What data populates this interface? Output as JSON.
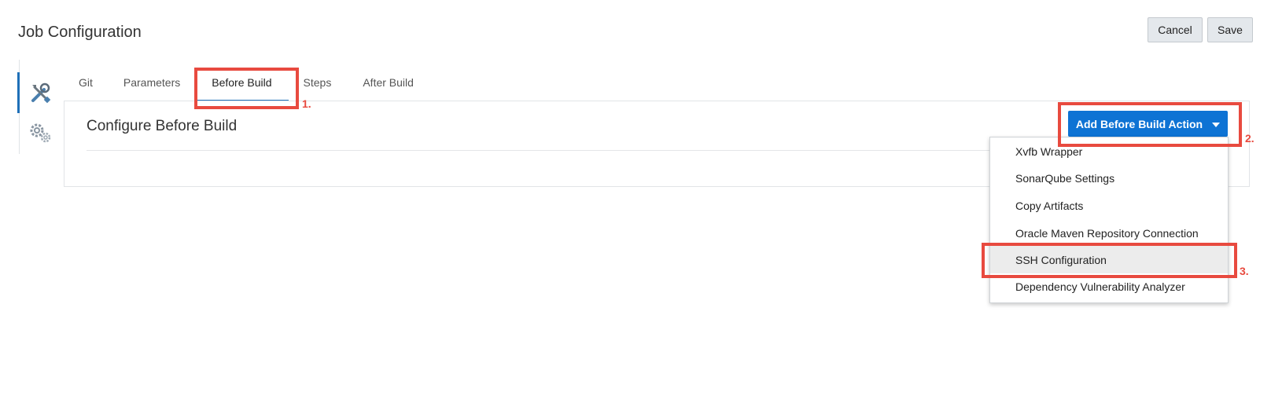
{
  "header": {
    "title": "Job Configuration",
    "cancel_label": "Cancel",
    "save_label": "Save"
  },
  "side_nav": {
    "items": [
      {
        "icon": "tools-icon",
        "active": true
      },
      {
        "icon": "gears-icon",
        "active": false
      }
    ]
  },
  "tabs": [
    {
      "label": "Git"
    },
    {
      "label": "Parameters"
    },
    {
      "label": "Before Build",
      "active": true
    },
    {
      "label": "Steps"
    },
    {
      "label": "After Build"
    }
  ],
  "panel": {
    "title": "Configure Before Build",
    "action_button_label": "Add Before Build Action"
  },
  "dropdown": {
    "items": [
      {
        "label": "Xvfb Wrapper"
      },
      {
        "label": "SonarQube Settings"
      },
      {
        "label": "Copy Artifacts"
      },
      {
        "label": "Oracle Maven Repository Connection"
      },
      {
        "label": "SSH Configuration",
        "highlighted": true
      },
      {
        "label": "Dependency Vulnerability Analyzer"
      }
    ]
  },
  "annotations": {
    "step1": "1.",
    "step2": "2.",
    "step3": "3."
  },
  "colors": {
    "accent": "#1f70b8",
    "primary_button": "#0e73d4",
    "callout": "#e84a3f"
  }
}
